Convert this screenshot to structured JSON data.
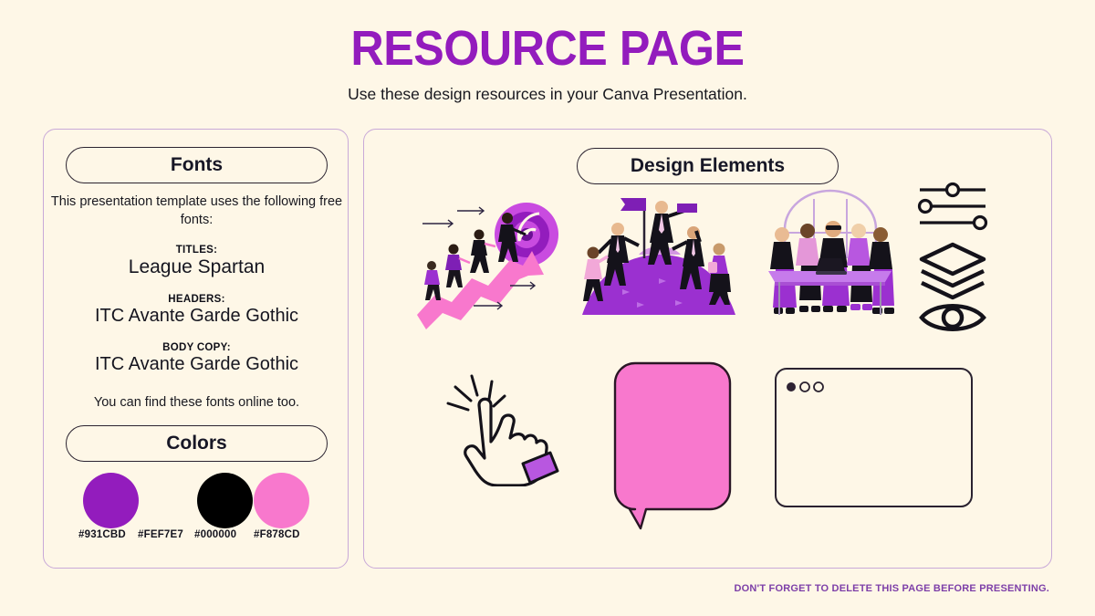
{
  "header": {
    "title": "RESOURCE PAGE",
    "subtitle": "Use these design resources in your Canva Presentation."
  },
  "left_panel": {
    "fonts_section": {
      "heading": "Fonts",
      "intro": "This presentation template uses the following free fonts:",
      "groups": [
        {
          "label": "TITLES:",
          "name": "League Spartan"
        },
        {
          "label": "HEADERS:",
          "name": "ITC Avante Garde Gothic"
        },
        {
          "label": "BODY COPY:",
          "name": "ITC Avante Garde Gothic"
        }
      ],
      "outro": "You can find these fonts online too."
    },
    "colors_section": {
      "heading": "Colors",
      "swatches": [
        {
          "hex": "#931CBD",
          "label": "#931CBD"
        },
        {
          "hex": "#FEF7E7",
          "label": "#FEF7E7"
        },
        {
          "hex": "#000000",
          "label": "#000000"
        },
        {
          "hex": "#F878CD",
          "label": "#F878CD"
        }
      ]
    }
  },
  "right_panel": {
    "heading": "Design Elements",
    "elements": [
      {
        "name": "growth-arrow-illustration"
      },
      {
        "name": "team-celebration-illustration"
      },
      {
        "name": "team-meeting-illustration"
      },
      {
        "name": "sliders-icon"
      },
      {
        "name": "layers-icon"
      },
      {
        "name": "eye-icon"
      },
      {
        "name": "click-hand-cursor-illustration"
      },
      {
        "name": "speech-bubble-shape"
      },
      {
        "name": "browser-window-mockup"
      }
    ]
  },
  "footer": {
    "note": "DON'T FORGET TO DELETE THIS PAGE BEFORE PRESENTING."
  },
  "theme": {
    "background": "#FEF7E7",
    "purple": "#931CBD",
    "pink": "#F878CD",
    "black": "#000000",
    "panel_border": "#c9a9d8",
    "footer_text": "#7d3fa8"
  }
}
